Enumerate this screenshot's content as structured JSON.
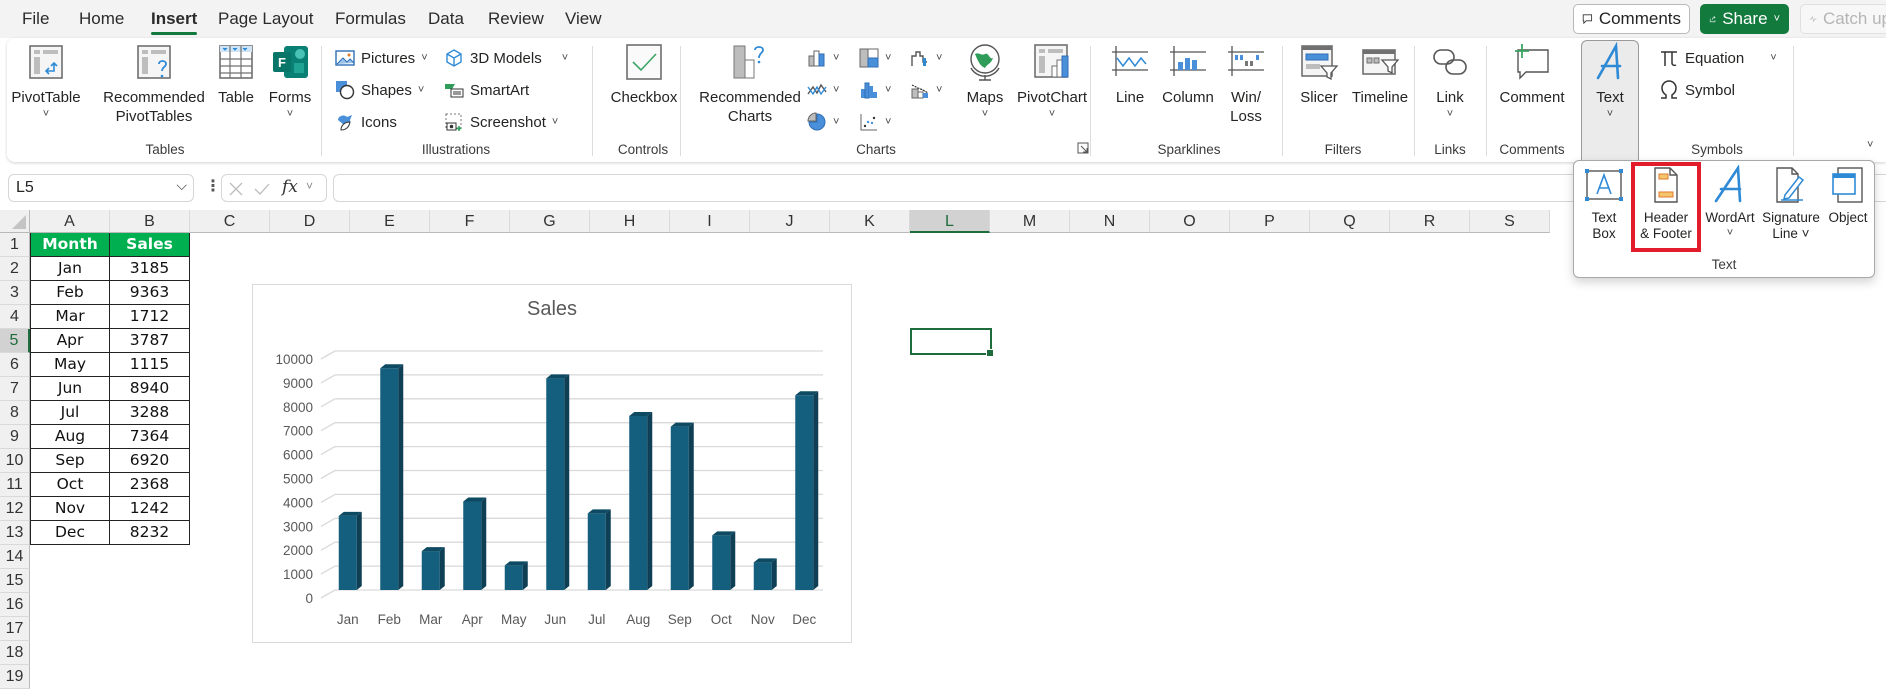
{
  "menu": {
    "tabs": [
      {
        "label": "File"
      },
      {
        "label": "Home"
      },
      {
        "label": "Insert",
        "active": true
      },
      {
        "label": "Page Layout"
      },
      {
        "label": "Formulas"
      },
      {
        "label": "Data"
      },
      {
        "label": "Review"
      },
      {
        "label": "View"
      }
    ],
    "comments_label": "Comments",
    "share_label": "Share",
    "catchup_label": "Catch up"
  },
  "ribbon": {
    "groups": {
      "tables": "Tables",
      "illustrations": "Illustrations",
      "controls": "Controls",
      "charts": "Charts",
      "sparklines": "Sparklines",
      "filters": "Filters",
      "links": "Links",
      "comments": "Comments",
      "symbols": "Symbols"
    },
    "pivottable": "PivotTable",
    "recommended_pivottables_1": "Recommended",
    "recommended_pivottables_2": "PivotTables",
    "table": "Table",
    "forms": "Forms",
    "pictures": "Pictures",
    "shapes": "Shapes",
    "icons": "Icons",
    "models3d": "3D Models",
    "smartart": "SmartArt",
    "screenshot": "Screenshot",
    "checkbox": "Checkbox",
    "recommended_charts_1": "Recommended",
    "recommended_charts_2": "Charts",
    "maps": "Maps",
    "pivotchart": "PivotChart",
    "line": "Line",
    "column": "Column",
    "winloss_1": "Win/",
    "winloss_2": "Loss",
    "slicer": "Slicer",
    "timeline": "Timeline",
    "link": "Link",
    "comment": "Comment",
    "text": "Text",
    "equation": "Equation",
    "symbol": "Symbol"
  },
  "text_panel": {
    "items": [
      {
        "line1": "Text",
        "line2": "Box"
      },
      {
        "line1": "Header",
        "line2": "& Footer",
        "highlighted": true
      },
      {
        "line1": "WordArt",
        "line2": "˅"
      },
      {
        "line1": "Signature",
        "line2": "Line ˅"
      },
      {
        "line1": "Object",
        "line2": ""
      }
    ],
    "group_label": "Text",
    "highlight_color": "#e21c2a"
  },
  "formula_bar": {
    "name_box": "L5",
    "formula": ""
  },
  "sheet": {
    "columns": [
      "A",
      "B",
      "C",
      "D",
      "E",
      "F",
      "G",
      "H",
      "I",
      "J",
      "K",
      "L",
      "M",
      "N",
      "O",
      "P",
      "Q",
      "R",
      "S"
    ],
    "rows": [
      "1",
      "2",
      "3",
      "4",
      "5",
      "6",
      "7",
      "8",
      "9",
      "10",
      "11",
      "12",
      "13",
      "14",
      "15",
      "16",
      "17",
      "18",
      "19"
    ],
    "selected_column": "L",
    "selected_row": "5",
    "header": [
      "Month",
      "Sales"
    ],
    "data": [
      [
        "Jan",
        "3185"
      ],
      [
        "Feb",
        "9363"
      ],
      [
        "Mar",
        "1712"
      ],
      [
        "Apr",
        "3787"
      ],
      [
        "May",
        "1115"
      ],
      [
        "Jun",
        "8940"
      ],
      [
        "Jul",
        "3288"
      ],
      [
        "Aug",
        "7364"
      ],
      [
        "Sep",
        "6920"
      ],
      [
        "Oct",
        "2368"
      ],
      [
        "Nov",
        "1242"
      ],
      [
        "Dec",
        "8232"
      ]
    ],
    "header_color": "#00b050"
  },
  "chart_data": {
    "type": "bar",
    "title": "Sales",
    "categories": [
      "Jan",
      "Feb",
      "Mar",
      "Apr",
      "May",
      "Jun",
      "Jul",
      "Aug",
      "Sep",
      "Oct",
      "Nov",
      "Dec"
    ],
    "values": [
      3185,
      9363,
      1712,
      3787,
      1115,
      8940,
      3288,
      7364,
      6920,
      2368,
      1242,
      8232
    ],
    "xlabel": "",
    "ylabel": "",
    "ylim": [
      0,
      10000
    ],
    "yticks": [
      0,
      1000,
      2000,
      3000,
      4000,
      5000,
      6000,
      7000,
      8000,
      9000,
      10000
    ],
    "grid": true,
    "legend": "none",
    "style": "3d-column",
    "bar_color": "#155f7e"
  }
}
